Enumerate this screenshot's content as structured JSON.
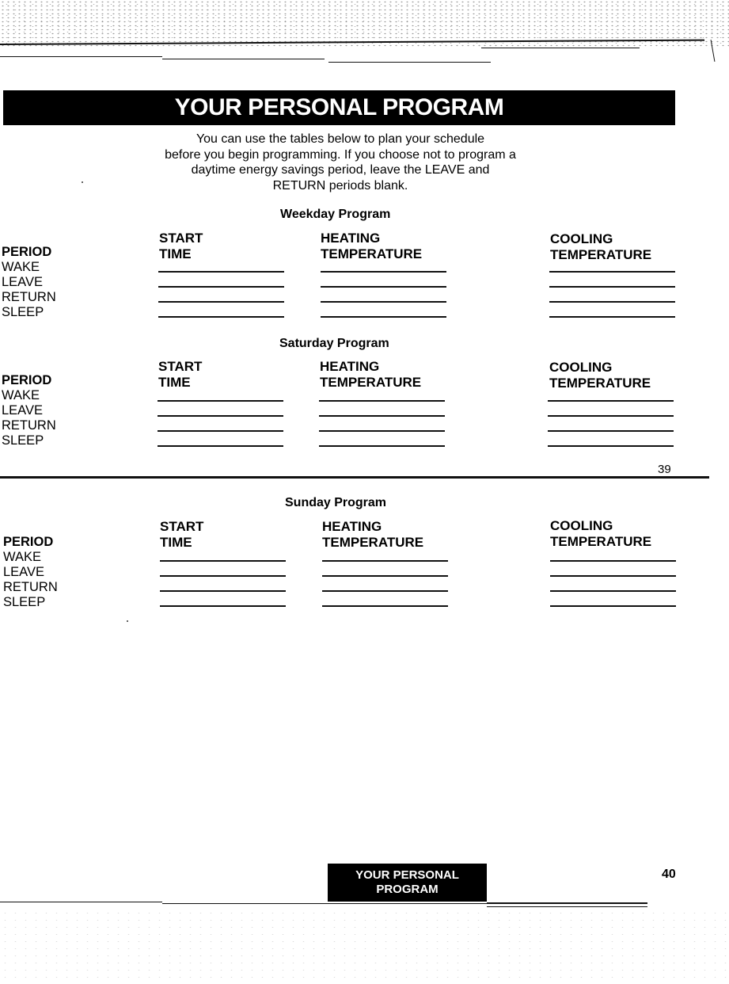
{
  "header": {
    "title": "YOUR PERSONAL PROGRAM",
    "intro_lines": [
      "You can use the tables below to plan your schedule",
      "before you begin programming. If you choose not to program a",
      "daytime energy savings period, leave the LEAVE and",
      "RETURN periods blank."
    ]
  },
  "columns": {
    "period": "PERIOD",
    "start_1": "START",
    "start_2": "TIME",
    "heating_1": "HEATING",
    "heating_2": "TEMPERATURE",
    "cooling_1": "COOLING",
    "cooling_2": "TEMPERATURE"
  },
  "periods": [
    "WAKE",
    "LEAVE",
    "RETURN",
    "SLEEP"
  ],
  "programs": [
    {
      "title": "Weekday Program"
    },
    {
      "title": "Saturday Program"
    },
    {
      "title": "Sunday Program"
    }
  ],
  "page_numbers": {
    "upper": "39",
    "lower": "40"
  },
  "footer": {
    "tab_line1": "YOUR PERSONAL",
    "tab_line2": "PROGRAM"
  }
}
